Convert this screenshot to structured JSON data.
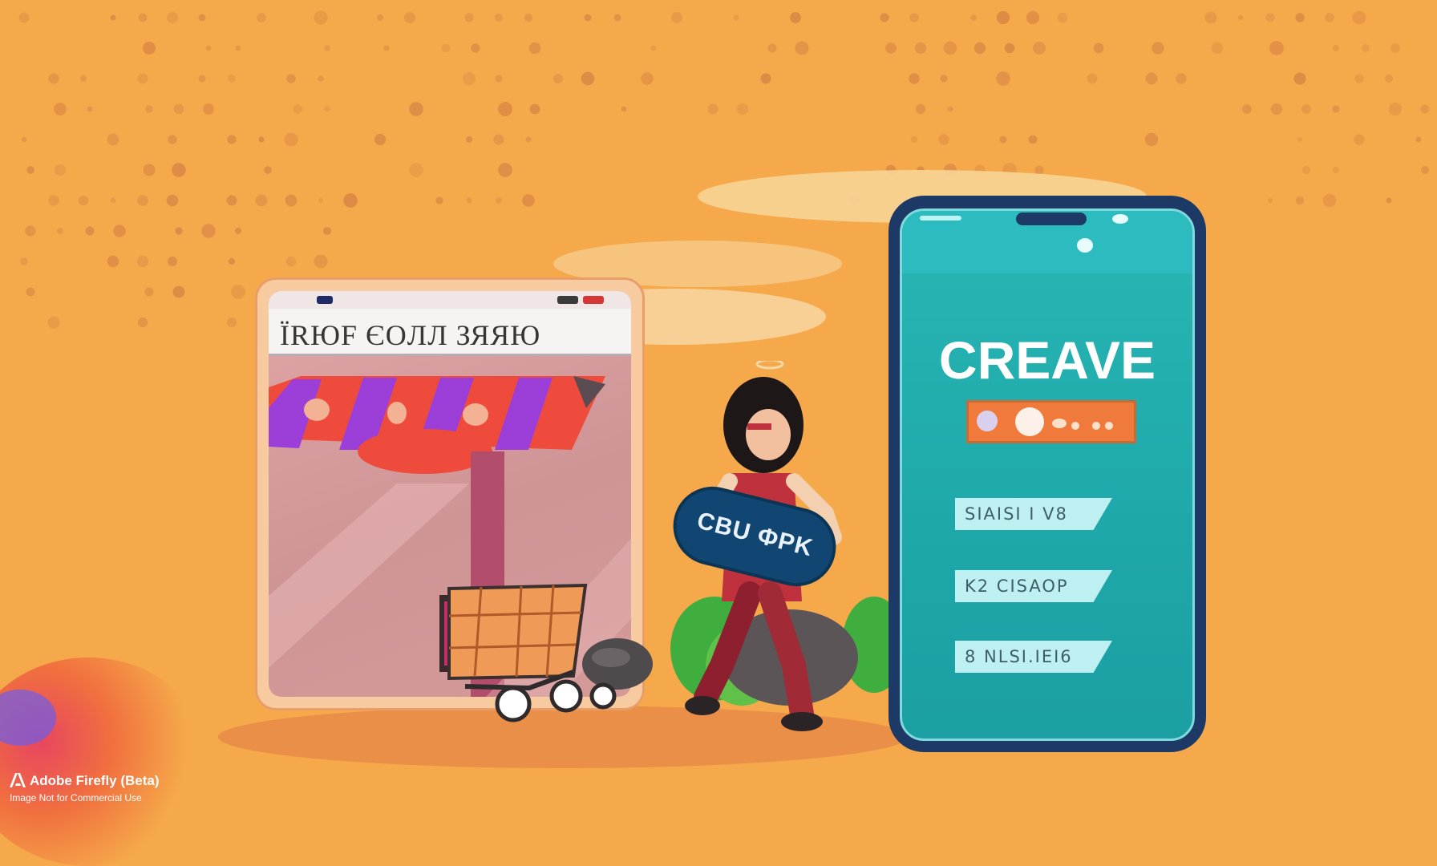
{
  "store": {
    "title": "ЇRЮF ЄOЛЛ ЗЯЯЮ"
  },
  "badge": {
    "text": "CBU ФPK"
  },
  "phone": {
    "title": "CREAVE",
    "menu": [
      {
        "label": "SIAISI I V8"
      },
      {
        "label": "K2 CISAOP"
      },
      {
        "label": "8 NLSI.IEI6"
      }
    ]
  },
  "watermark": {
    "line1": "Adobe Firefly (Beta)",
    "line2": "Image Not for Commercial Use"
  },
  "colors": {
    "background": "#f5a94a",
    "phone_frame": "#1d3a66",
    "phone_screen": "#29b6b4",
    "awning_red": "#ef4b3d",
    "awning_purple": "#9b3fd8",
    "badge": "#124672"
  }
}
